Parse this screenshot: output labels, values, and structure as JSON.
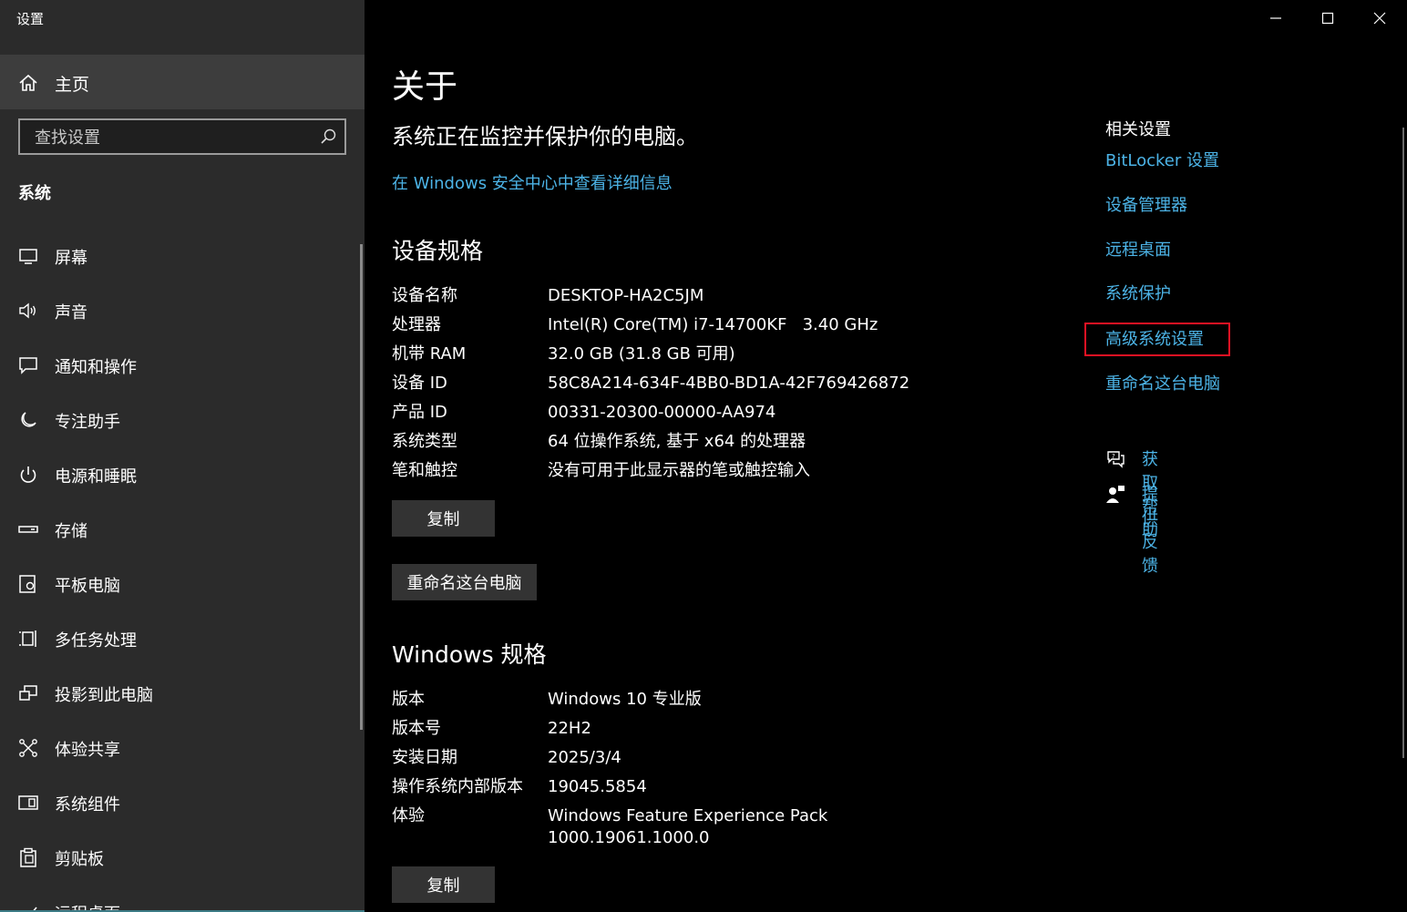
{
  "app": {
    "title": "设置"
  },
  "sidebar": {
    "home_label": "主页",
    "search_placeholder": "查找设置",
    "section_title": "系统",
    "items": [
      {
        "label": "屏幕",
        "icon": "display-icon"
      },
      {
        "label": "声音",
        "icon": "speaker-icon"
      },
      {
        "label": "通知和操作",
        "icon": "notification-icon"
      },
      {
        "label": "专注助手",
        "icon": "moon-icon"
      },
      {
        "label": "电源和睡眠",
        "icon": "power-icon"
      },
      {
        "label": "存储",
        "icon": "storage-icon"
      },
      {
        "label": "平板电脑",
        "icon": "tablet-icon"
      },
      {
        "label": "多任务处理",
        "icon": "multitasking-icon"
      },
      {
        "label": "投影到此电脑",
        "icon": "project-icon"
      },
      {
        "label": "体验共享",
        "icon": "share-icon"
      },
      {
        "label": "系统组件",
        "icon": "components-icon"
      },
      {
        "label": "剪贴板",
        "icon": "clipboard-icon"
      },
      {
        "label": "远程桌面",
        "icon": "remote-desktop-icon"
      }
    ]
  },
  "main": {
    "title": "关于",
    "status": "系统正在监控并保护你的电脑。",
    "security_link": "在 Windows 安全中心中查看详细信息",
    "device_specs": {
      "title": "设备规格",
      "rows": [
        {
          "key": "设备名称",
          "value": "DESKTOP-HA2C5JM"
        },
        {
          "key": "处理器",
          "value": "Intel(R) Core(TM) i7-14700KF   3.40 GHz"
        },
        {
          "key": "机带 RAM",
          "value": "32.0 GB (31.8 GB 可用)"
        },
        {
          "key": "设备 ID",
          "value": "58C8A214-634F-4BB0-BD1A-42F769426872"
        },
        {
          "key": "产品 ID",
          "value": "00331-20300-00000-AA974"
        },
        {
          "key": "系统类型",
          "value": "64 位操作系统, 基于 x64 的处理器"
        },
        {
          "key": "笔和触控",
          "value": "没有可用于此显示器的笔或触控输入"
        }
      ],
      "copy_button": "复制",
      "rename_button": "重命名这台电脑"
    },
    "windows_specs": {
      "title": "Windows 规格",
      "rows": [
        {
          "key": "版本",
          "value": "Windows 10 专业版"
        },
        {
          "key": "版本号",
          "value": "22H2"
        },
        {
          "key": "安装日期",
          "value": "2025/3/4"
        },
        {
          "key": "操作系统内部版本",
          "value": "19045.5854"
        },
        {
          "key": "体验",
          "value": "Windows Feature Experience Pack",
          "value2": "1000.19061.1000.0"
        }
      ],
      "copy_button": "复制"
    }
  },
  "related": {
    "title": "相关设置",
    "links": [
      "BitLocker 设置",
      "设备管理器",
      "远程桌面",
      "系统保护",
      "高级系统设置",
      "重命名这台电脑"
    ],
    "help_link": "获取帮助",
    "feedback_link": "提供反馈"
  },
  "colors": {
    "link": "#4cb3e6",
    "highlight": "#e81123",
    "sidebar_bg": "#2b2b2b"
  }
}
